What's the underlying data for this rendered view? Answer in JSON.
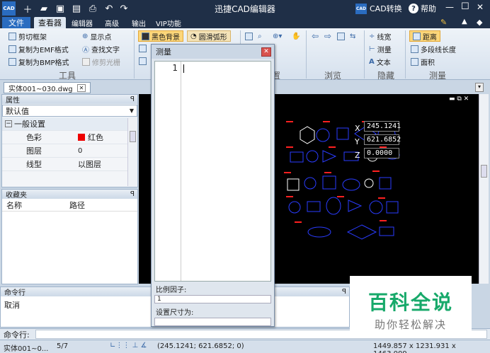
{
  "app": {
    "title": "迅捷CAD编辑器",
    "logo": "CAD",
    "cad_convert": "CAD转换",
    "help": "帮助",
    "controls": [
      "—",
      "☐",
      "✕"
    ]
  },
  "menu": {
    "tabs": [
      "文件",
      "查看器",
      "编辑器",
      "高级",
      "输出",
      "VIP功能"
    ]
  },
  "ribbon": {
    "tools": {
      "label": "工具",
      "items": [
        "剪切框架",
        "复制为EMF格式",
        "复制为BMP格式",
        "显示点",
        "查找文字",
        "修剪光栅"
      ]
    },
    "position": {
      "label": "位置",
      "items": [
        "黑色背景",
        "圆滑弧形"
      ]
    },
    "browse": {
      "label": "浏览"
    },
    "hide": {
      "label": "隐藏",
      "items": [
        "线宽",
        "测量",
        "文本"
      ]
    },
    "measure": {
      "label": "测量",
      "items": [
        "距离",
        "多段线长度",
        "面积"
      ]
    }
  },
  "document": {
    "tab": "实体001~030.dwg"
  },
  "properties": {
    "header": "属性",
    "dropdown": "默认值",
    "section": "一般设置",
    "rows": [
      {
        "name": "色彩",
        "value": "红色"
      },
      {
        "name": "图层",
        "value": "0"
      },
      {
        "name": "线型",
        "value": "以图层"
      }
    ]
  },
  "favorites": {
    "header": "收藏夹",
    "columns": [
      "名称",
      "路径"
    ]
  },
  "dialog": {
    "title": "测量",
    "line_no": "1",
    "scale_label": "比例因子:",
    "scale_value": "1",
    "size_label": "设置尺寸为:"
  },
  "coords": {
    "x_label": "X",
    "x": "245.1241",
    "y_label": "Y",
    "y": "621.6852",
    "z_label": "Z",
    "z": "0.0000"
  },
  "command": {
    "header": "命令行",
    "text": "取消",
    "prompt": "命令行:"
  },
  "status": {
    "file": "实体001~0...",
    "page": "5/7",
    "coords": "(245.1241; 621.6852; 0)",
    "extent": "1449.857 x 1231.931 x 1463.009"
  },
  "watermark": {
    "title": "百科全说",
    "subtitle": "助你轻松解决"
  }
}
